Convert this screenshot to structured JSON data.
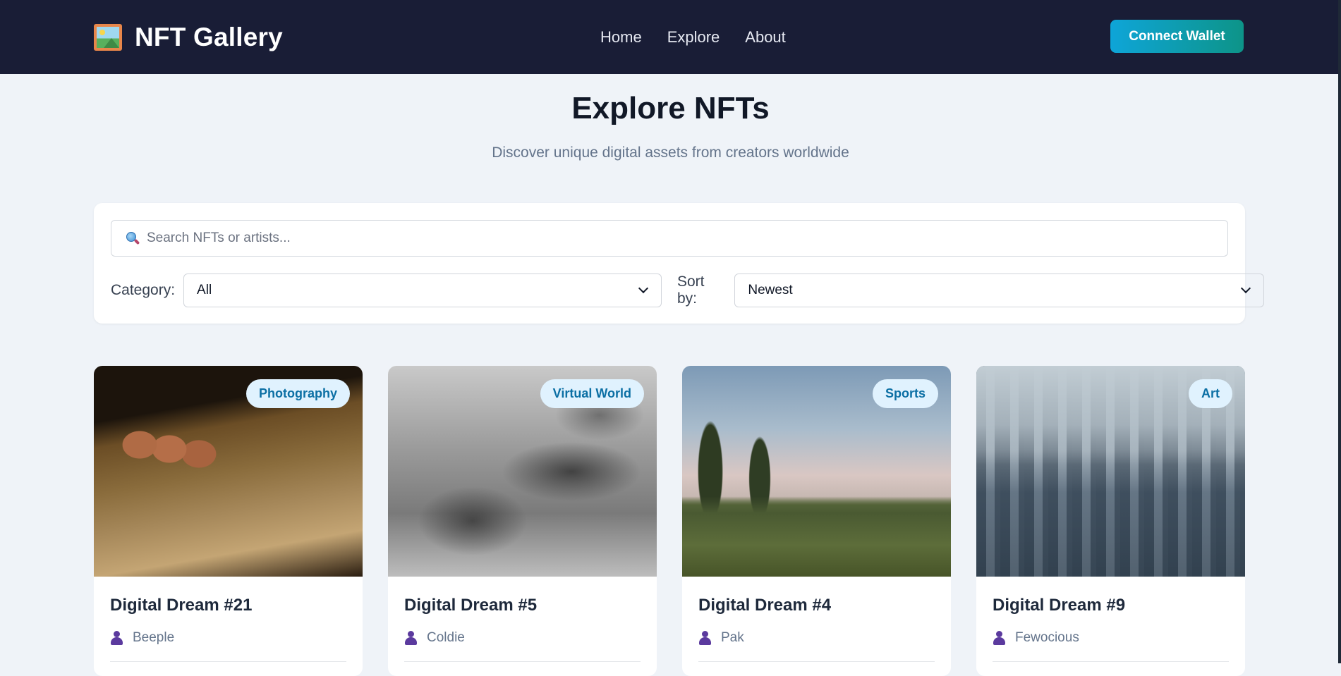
{
  "header": {
    "logo_icon": "framed-picture-icon",
    "brand": "NFT Gallery",
    "nav": [
      "Home",
      "Explore",
      "About"
    ],
    "connect_label": "Connect Wallet",
    "accent_gradient": [
      "#0ea5d8",
      "#0d9488"
    ],
    "bg_color": "#191d36"
  },
  "hero": {
    "title": "Explore NFTs",
    "subtitle": "Discover unique digital assets from creators worldwide"
  },
  "filters": {
    "search_icon": "magnifying-glass-icon",
    "search_placeholder": "Search NFTs or artists...",
    "category_label": "Category:",
    "category_value": "All",
    "sort_label": "Sort by:",
    "sort_value": "Newest"
  },
  "cards": [
    {
      "title": "Digital Dream #21",
      "artist": "Beeple",
      "category": "Photography"
    },
    {
      "title": "Digital Dream #5",
      "artist": "Coldie",
      "category": "Virtual World"
    },
    {
      "title": "Digital Dream #4",
      "artist": "Pak",
      "category": "Sports"
    },
    {
      "title": "Digital Dream #9",
      "artist": "Fewocious",
      "category": "Art"
    }
  ],
  "colors": {
    "badge_bg": "#e0f2fe",
    "badge_text": "#0b6fa4",
    "page_bg": "#eff3f8"
  }
}
